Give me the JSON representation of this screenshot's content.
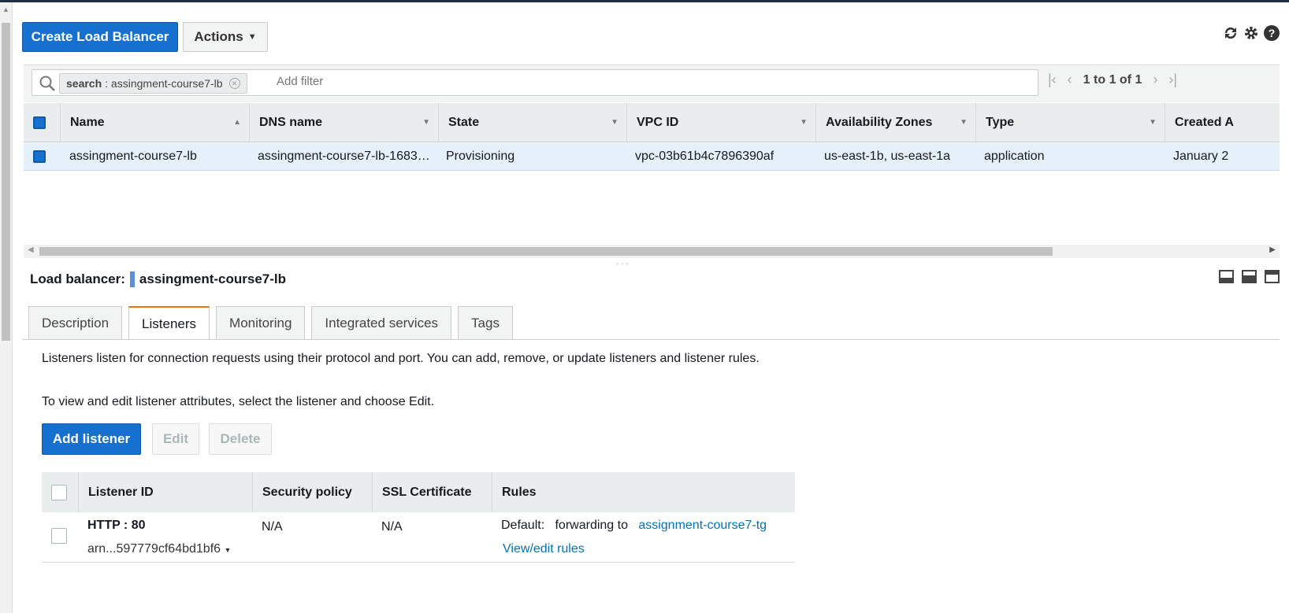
{
  "toolbar": {
    "create_label": "Create Load Balancer",
    "actions_label": "Actions"
  },
  "icons": [
    "refresh-icon",
    "gear-icon",
    "help-icon"
  ],
  "filter": {
    "chip_key": "search",
    "chip_value": ": assingment-course7-lb",
    "placeholder": "Add filter",
    "pagination": "1 to 1 of 1"
  },
  "lb_table": {
    "headers": [
      "Name",
      "DNS name",
      "State",
      "VPC ID",
      "Availability Zones",
      "Type",
      "Created A"
    ],
    "row": {
      "name": "assingment-course7-lb",
      "dns": "assingment-course7-lb-1683…",
      "state": "Provisioning",
      "vpc": "vpc-03b61b4c7896390af",
      "azs": "us-east-1b, us-east-1a",
      "type": "application",
      "created": "January 2"
    }
  },
  "details": {
    "label": "Load balancer:",
    "name": "assingment-course7-lb",
    "tabs": [
      "Description",
      "Listeners",
      "Monitoring",
      "Integrated services",
      "Tags"
    ],
    "active_tab": "Listeners"
  },
  "listeners": {
    "intro1": "Listeners listen for connection requests using their protocol and port. You can add, remove, or update listeners and listener rules.",
    "intro2": "To view and edit listener attributes, select the listener and choose Edit.",
    "add_label": "Add listener",
    "edit_label": "Edit",
    "delete_label": "Delete",
    "headers": [
      "Listener ID",
      "Security policy",
      "SSL Certificate",
      "Rules"
    ],
    "row": {
      "id": "HTTP : 80",
      "arn": "arn...597779cf64bd1bf6",
      "security_policy": "N/A",
      "ssl": "N/A",
      "default_label": "Default:",
      "forwarding_label": "forwarding to",
      "target": "assignment-course7-tg",
      "view_rules": "View/edit rules"
    }
  },
  "colors": {
    "primary": "#1670d0",
    "accent": "#ec7211",
    "link": "#0073bb",
    "selected_row": "#e6f0fa"
  }
}
